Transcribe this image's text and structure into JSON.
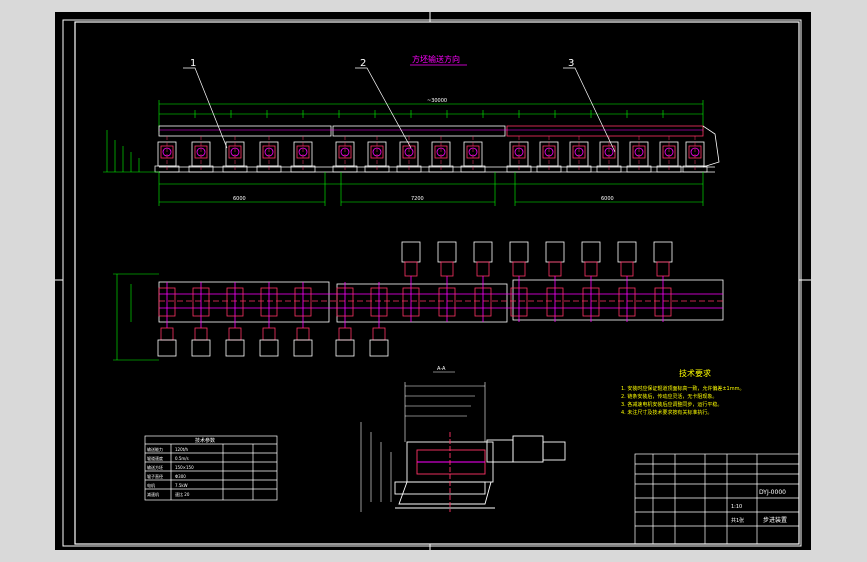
{
  "drawing": {
    "flow_direction_label": "方坯输送方向",
    "balloons": [
      {
        "number": "1"
      },
      {
        "number": "2"
      },
      {
        "number": "3"
      }
    ],
    "overall_dimension": "~30000",
    "section_dimensions": [
      "6000",
      "7200",
      "6000"
    ],
    "tech_requirements": {
      "title": "技术要求",
      "items": [
        "1. 安装时应保证辊道顶面标高一致，允许偏差±1mm。",
        "2. 链条安装后，传动应灵活，无卡阻现象。",
        "3. 各减速电机安装后应调整同步，运行平稳。",
        "4. 未注尺寸及技术要求按有关标准执行。"
      ]
    },
    "params_table": {
      "title": "技术参数",
      "rows": [
        [
          "输送能力",
          "120t/h"
        ],
        [
          "辊道速度",
          "0.5m/s"
        ],
        [
          "输送方坯",
          "150×150"
        ],
        [
          "辊子直径",
          "Φ300"
        ],
        [
          "电机",
          "7.5kW"
        ],
        [
          "减速机",
          "速比 20"
        ]
      ]
    },
    "title_block": {
      "drawing_no": "DYJ-0000",
      "name": "步进装置",
      "scale": "1:10",
      "sheet": "共1张"
    }
  }
}
